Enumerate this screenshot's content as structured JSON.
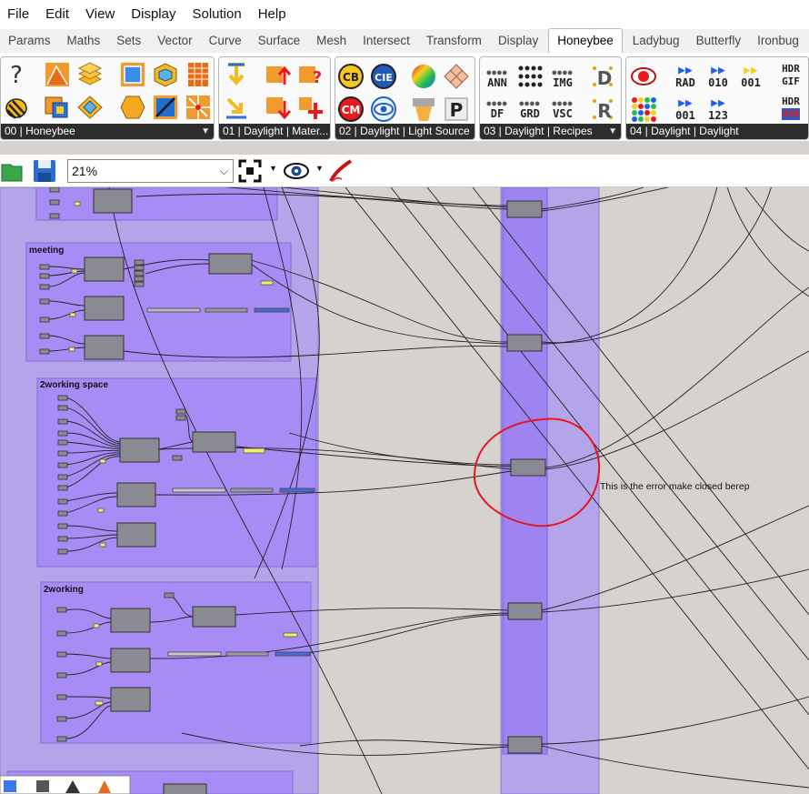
{
  "menu": [
    "File",
    "Edit",
    "View",
    "Display",
    "Solution",
    "Help"
  ],
  "tabs": [
    "Params",
    "Maths",
    "Sets",
    "Vector",
    "Curve",
    "Surface",
    "Mesh",
    "Intersect",
    "Transform",
    "Display",
    "Honeybee",
    "Ladybug",
    "Butterfly",
    "Ironbug"
  ],
  "active_tab": "Honeybee",
  "ribbon_groups": [
    {
      "caption": "00 | Honeybee"
    },
    {
      "caption": "01 | Daylight | Mater..."
    },
    {
      "caption": "02 | Daylight | Light Source"
    },
    {
      "caption": "03 | Daylight | Recipes"
    },
    {
      "caption": "04 | Daylight | Daylight"
    }
  ],
  "ribbon_text_icons": {
    "cb": "CB",
    "cie": "CIE",
    "cm": "CM",
    "ann": "ANN",
    "img": "IMG",
    "df": "DF",
    "grd": "GRD",
    "vsc": "VSC",
    "p": "P",
    "d": "D",
    "r": "R",
    "rad": "RAD",
    "bin010": "010",
    "bin001a": "001",
    "bin001b": "001",
    "n123": "123",
    "hdr": "HDR",
    "gif": "GIF",
    "hdr2": "HDR",
    "hdr3": "HDR"
  },
  "toolbar": {
    "zoom": "21%"
  },
  "canvas": {
    "groups": [
      "meeting",
      "2working space",
      "2working"
    ],
    "annotation": "This is the error make closed berep"
  },
  "colors": {
    "group_fill": "#a994f2",
    "component": "#8a8a92",
    "error_circle": "#e8141e",
    "panel_yellow": "#f5ec6a",
    "panel_blue": "#4a68d8"
  }
}
